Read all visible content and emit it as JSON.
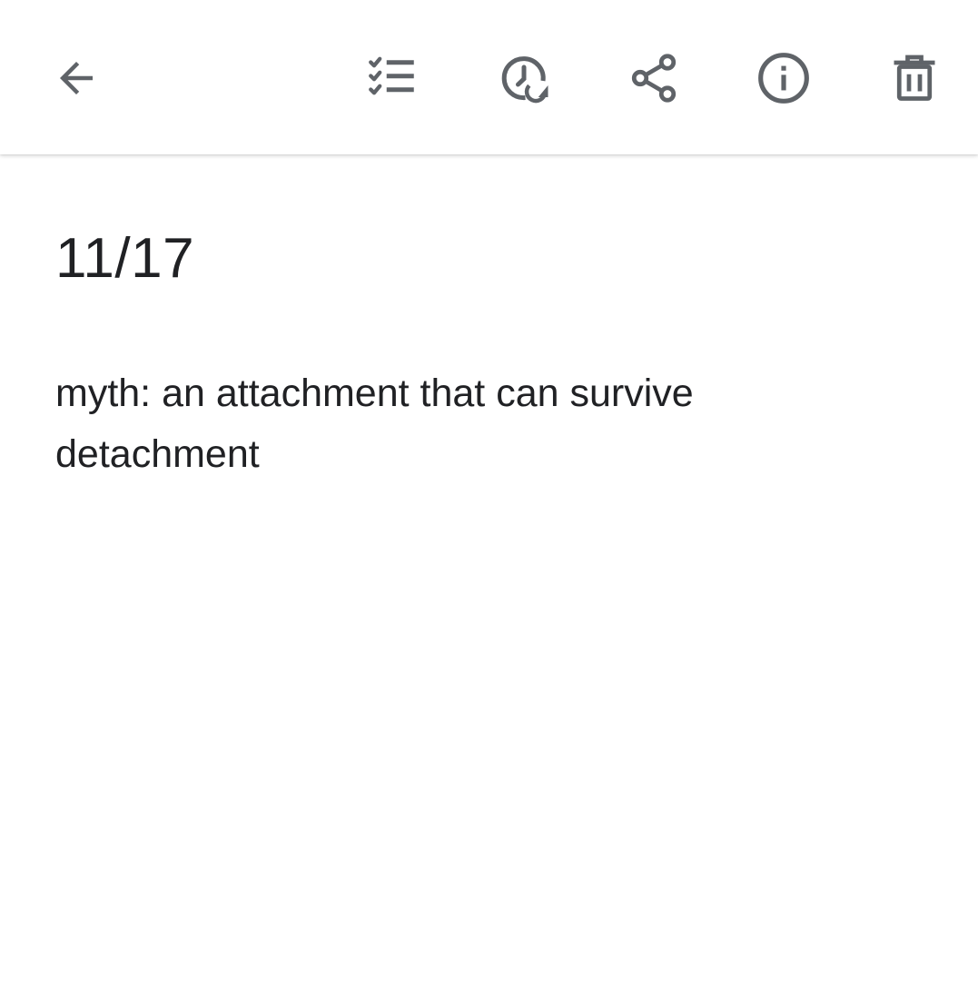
{
  "icons": {
    "back": "arrow-back-icon",
    "checklist": "checklist-icon",
    "reminder": "reminder-clock-icon",
    "share": "share-icon",
    "info": "info-icon",
    "delete": "trash-icon"
  },
  "colors": {
    "icon": "#5f6368",
    "text": "#202124",
    "background": "#ffffff"
  },
  "note": {
    "title": "11/17",
    "body": "myth: an attachment that can survive detachment"
  }
}
